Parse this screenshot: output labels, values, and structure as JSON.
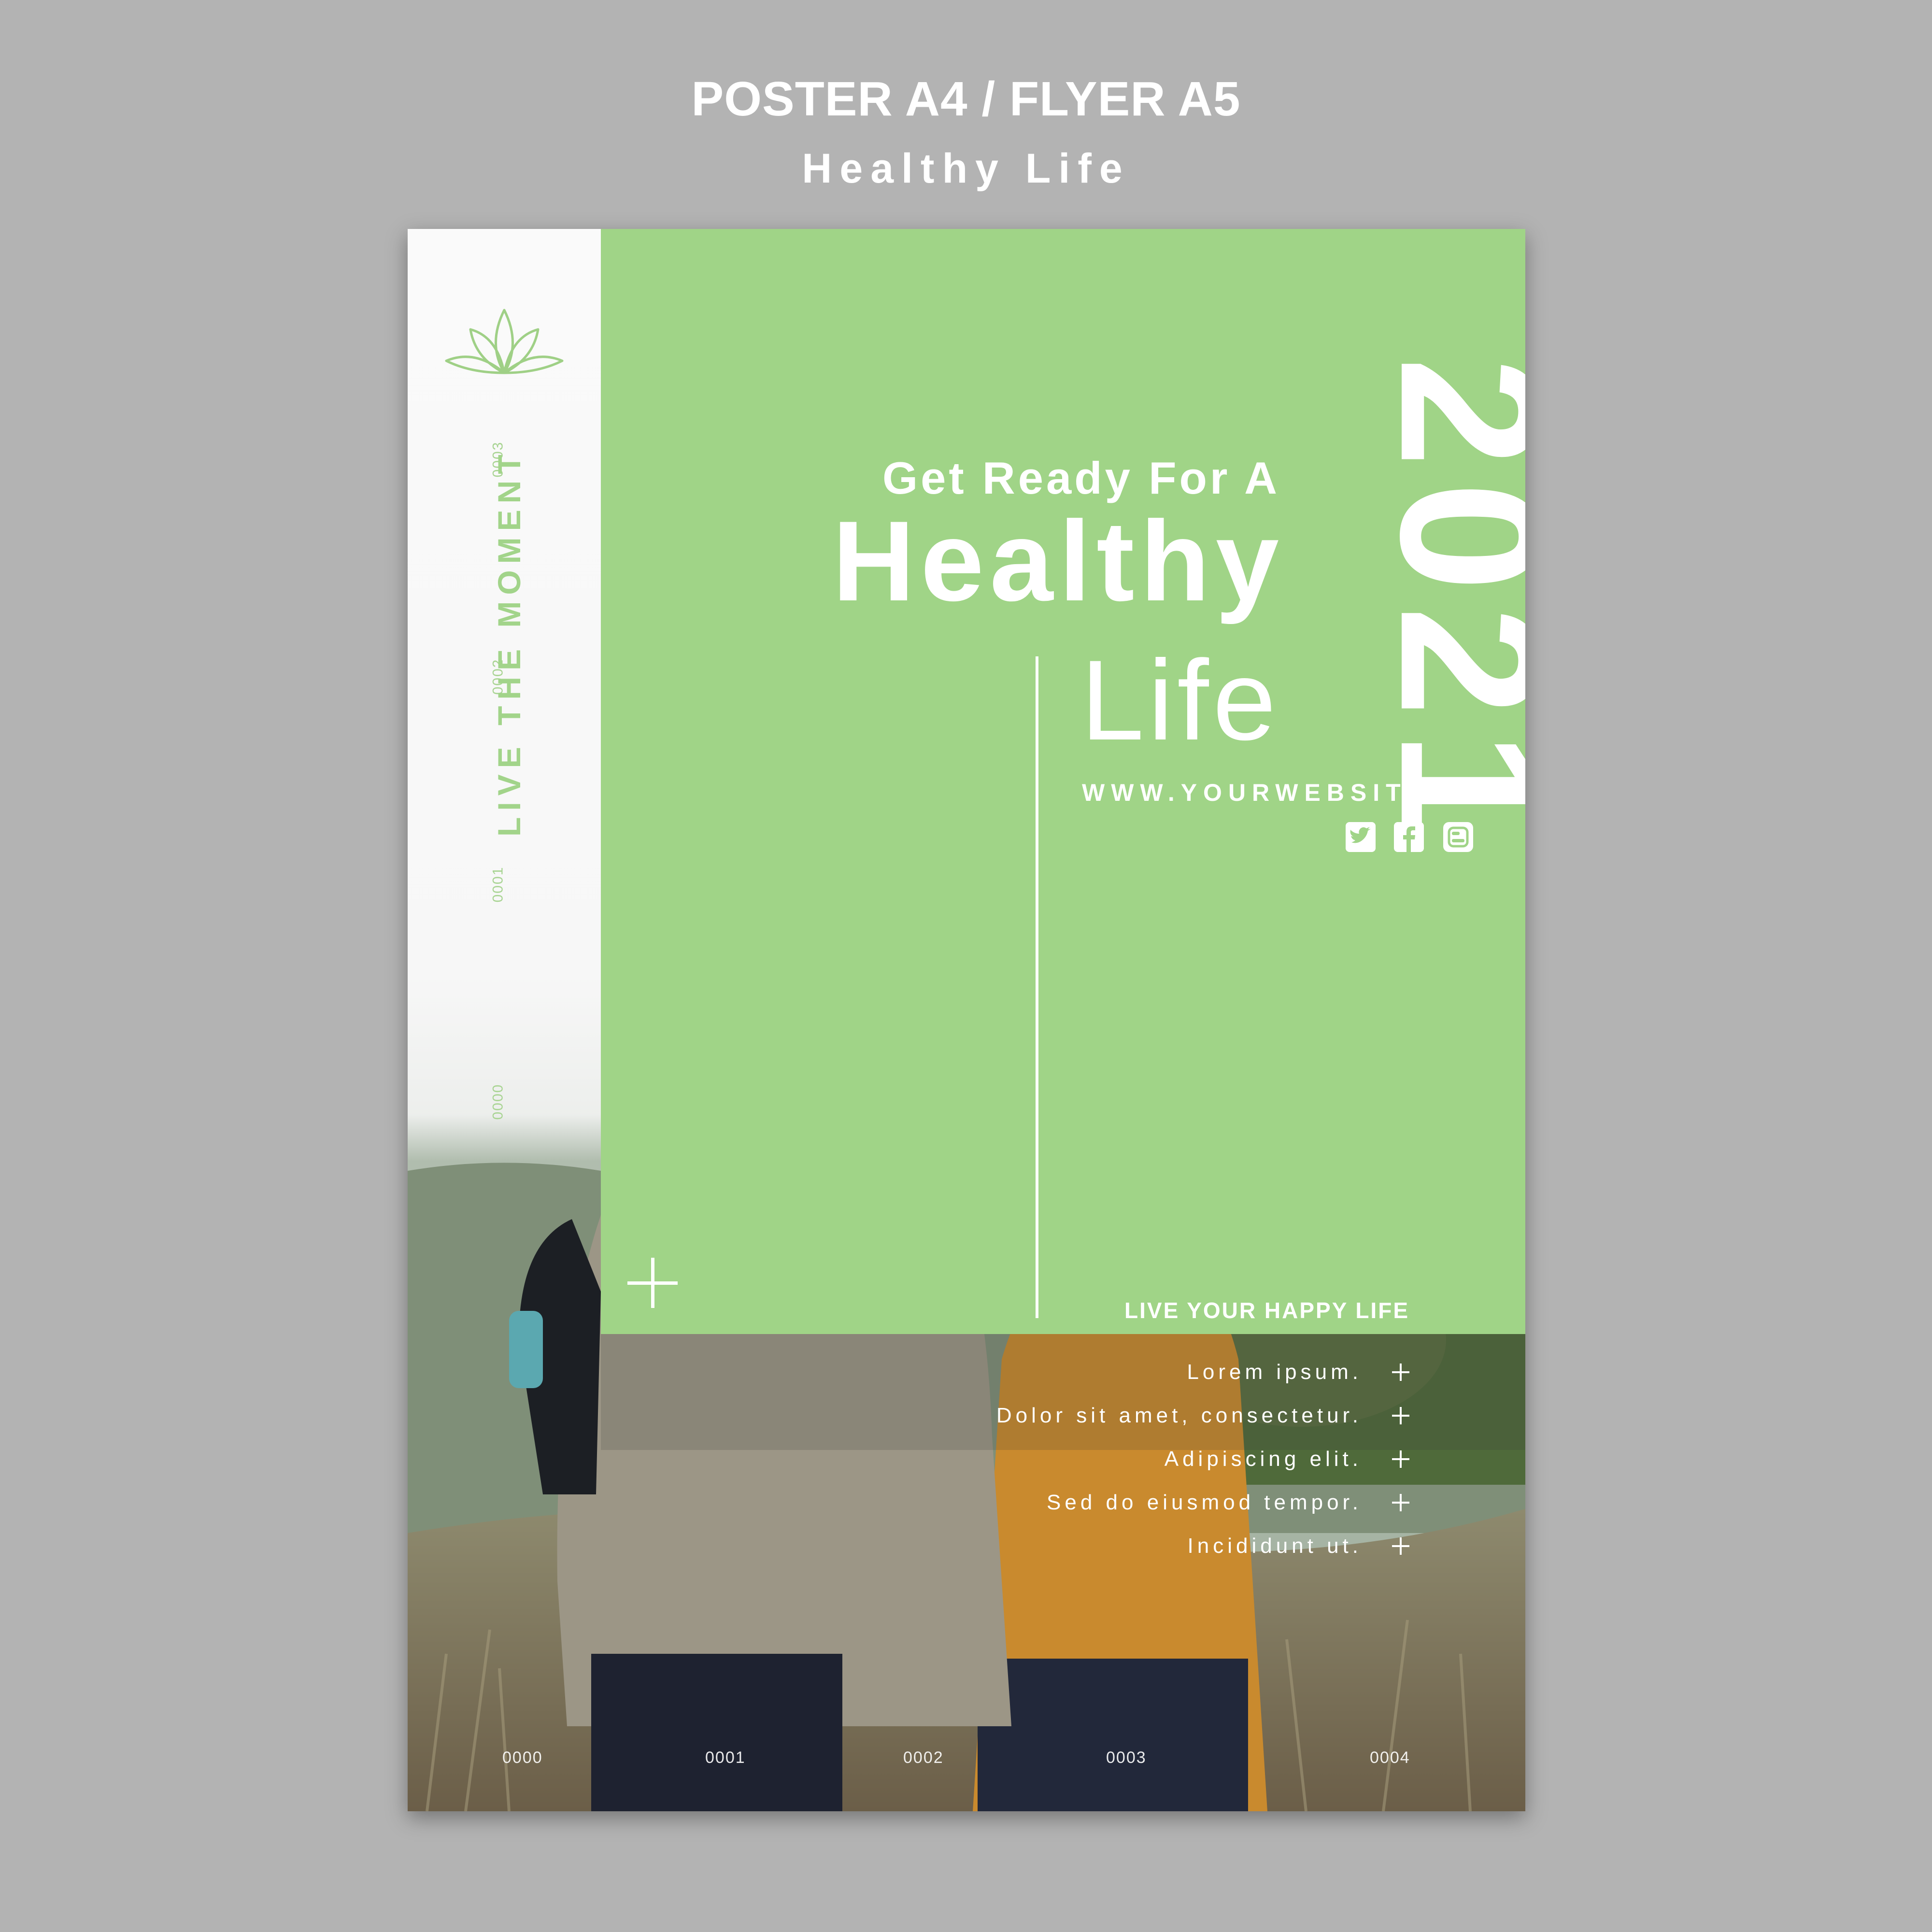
{
  "header": {
    "title": "POSTER A4 / FLYER A5",
    "subtitle": "Healthy Life"
  },
  "poster": {
    "side_numbers": [
      "0003",
      "0002",
      "0001",
      "0000"
    ],
    "side_tagline": "LIVE THE MOMENT",
    "year": "2021",
    "headline_intro": "Get Ready For A",
    "headline_main": "Healthy",
    "headline_end": "Life",
    "website": "WWW.YOURWEBSITE.COM",
    "social_icons": [
      "twitter-icon",
      "facebook-icon",
      "blogger-icon"
    ],
    "section_title": "LIVE YOUR HAPPY LIFE",
    "list_items": [
      "Lorem ipsum.",
      "Dolor sit amet, consectetur.",
      "Adipiscing elit.",
      "Sed do eiusmod tempor.",
      "Incididunt ut."
    ],
    "footer_numbers": [
      "0000",
      "0001",
      "0002",
      "0003",
      "0004"
    ]
  },
  "colors": {
    "background": "#b3b3b3",
    "accent_green": "#a0d487",
    "sidebar": "#f8f8f8",
    "text_light": "#ffffff"
  }
}
